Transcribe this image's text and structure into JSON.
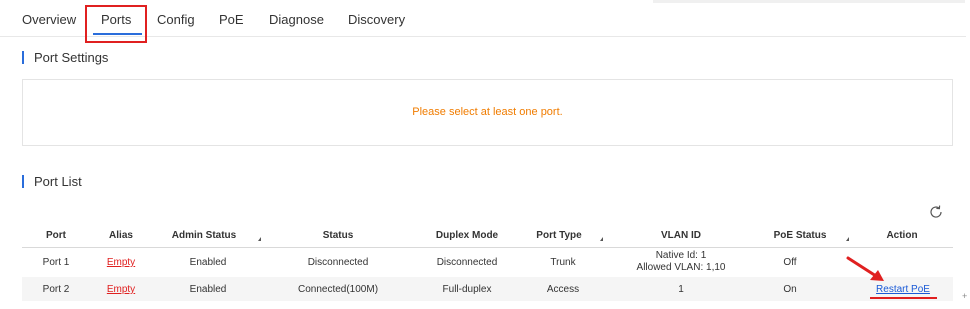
{
  "tabs": [
    {
      "label": "Overview"
    },
    {
      "label": "Ports"
    },
    {
      "label": "Config"
    },
    {
      "label": "PoE"
    },
    {
      "label": "Diagnose"
    },
    {
      "label": "Discovery"
    }
  ],
  "active_tab": "Ports",
  "port_settings": {
    "title": "Port Settings",
    "message": "Please select at least one port."
  },
  "port_list": {
    "title": "Port List",
    "refresh_icon": "refresh-icon",
    "columns": [
      "Port",
      "Alias",
      "Admin Status",
      "Status",
      "Duplex Mode",
      "Port Type",
      "VLAN ID",
      "PoE Status",
      "Action"
    ],
    "rows": [
      {
        "port": "Port 1",
        "alias": "Empty",
        "admin_status": "Enabled",
        "status": "Disconnected",
        "duplex_mode": "Disconnected",
        "port_type": "Trunk",
        "vlan_native": "Native Id: 1",
        "vlan_allowed": "Allowed VLAN: 1,10",
        "poe_status": "Off",
        "action": ""
      },
      {
        "port": "Port 2",
        "alias": "Empty",
        "admin_status": "Enabled",
        "status": "Connected(100M)",
        "duplex_mode": "Full-duplex",
        "port_type": "Access",
        "vlan_id": "1",
        "poe_status": "On",
        "action": "Restart PoE"
      }
    ]
  },
  "colors": {
    "accent": "#2a6ddb",
    "warning_text": "#f07c00",
    "alias_link": "#e02020",
    "action_link": "#1a5ad7",
    "annotation": "#e02020"
  }
}
